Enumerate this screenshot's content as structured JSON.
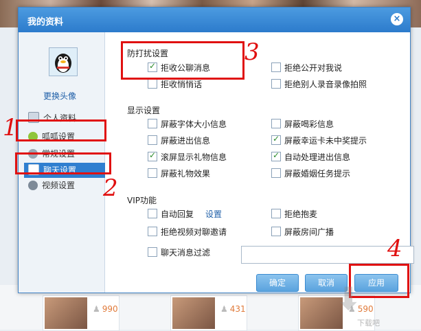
{
  "dialog": {
    "title": "我的资料",
    "close_label": "×",
    "change_avatar": "更换头像"
  },
  "nav": [
    {
      "label": "个人资料",
      "icon": "id-card-icon"
    },
    {
      "label": "呱呱设置",
      "icon": "frog-icon"
    },
    {
      "label": "常规设置",
      "icon": "gear-icon"
    },
    {
      "label": "聊天设置",
      "icon": "chat-icon",
      "active": true
    },
    {
      "label": "视频设置",
      "icon": "video-icon"
    }
  ],
  "sections": {
    "disturb": {
      "title": "防打扰设置",
      "options": [
        {
          "label": "拒收公聊消息",
          "checked": true
        },
        {
          "label": "拒绝公开对我说",
          "checked": false
        },
        {
          "label": "拒收悄悄话",
          "checked": false
        },
        {
          "label": "拒绝别人录音录像拍照",
          "checked": false
        }
      ]
    },
    "display": {
      "title": "显示设置",
      "options": [
        {
          "label": "屏蔽字体大小信息",
          "checked": false
        },
        {
          "label": "屏蔽喝彩信息",
          "checked": false
        },
        {
          "label": "屏蔽进出信息",
          "checked": false
        },
        {
          "label": "屏蔽幸运卡未中奖提示",
          "checked": true
        },
        {
          "label": "滚屏显示礼物信息",
          "checked": true
        },
        {
          "label": "自动处理进出信息",
          "checked": true
        },
        {
          "label": "屏蔽礼物效果",
          "checked": false
        },
        {
          "label": "屏蔽婚姻任务提示",
          "checked": false
        }
      ]
    },
    "vip": {
      "title": "VIP功能",
      "options": [
        {
          "label": "自动回复",
          "checked": false,
          "link": "设置"
        },
        {
          "label": "拒绝抱麦",
          "checked": false
        },
        {
          "label": "拒绝视频对聊邀请",
          "checked": false
        },
        {
          "label": "屏蔽房间广播",
          "checked": false
        },
        {
          "label": "聊天消息过滤",
          "checked": false
        }
      ],
      "filter_value": ""
    }
  },
  "buttons": {
    "ok": "确定",
    "cancel": "取消",
    "apply": "应用"
  },
  "annotations": [
    "1",
    "2",
    "3",
    "4"
  ],
  "background_counts": [
    "990",
    "431",
    "590"
  ],
  "watermark": "下载吧",
  "colors": {
    "titlebar": "#2c7bcc",
    "active_nav": "#2f7fd0",
    "annotation_red": "#e01010",
    "button": "#5aa3de"
  }
}
